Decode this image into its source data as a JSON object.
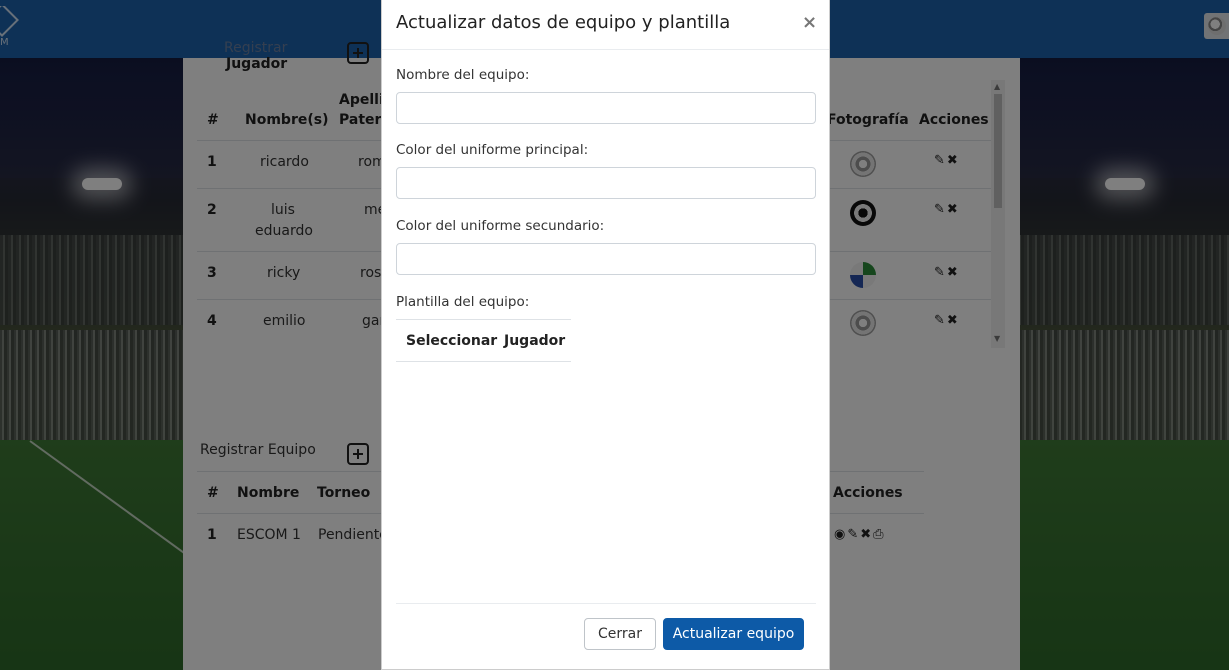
{
  "background": {
    "navbar_color": "#1c63ad"
  },
  "navbar": {
    "brand_text": "M"
  },
  "players_section": {
    "register_label_line1": "Registrar",
    "register_label_line2": "Jugador",
    "headers": {
      "num": "#",
      "names": "Nombre(s)",
      "surname_line1": "Apellid",
      "surname_line2": "Patern",
      "photo": "Fotografía",
      "actions": "Acciones"
    },
    "rows": [
      {
        "num": "1",
        "name": "ricardo",
        "surname": "rom",
        "photo": "gray-ball"
      },
      {
        "num": "2",
        "name_line1": "luis",
        "name_line2": "eduardo",
        "surname": "me",
        "photo": "black-ball"
      },
      {
        "num": "3",
        "name": "ricky",
        "surname": "rosa",
        "photo": "color-ball"
      },
      {
        "num": "4",
        "name": "emilio",
        "surname": "gar",
        "photo": "gray-ball"
      }
    ]
  },
  "teams_section": {
    "register_label": "Registrar Equipo",
    "headers": {
      "num": "#",
      "name": "Nombre",
      "tournament": "Torneo",
      "actions": "Acciones"
    },
    "rows": [
      {
        "num": "1",
        "name": "ESCOM 1",
        "tournament": "Pendiente"
      }
    ]
  },
  "modal": {
    "title": "Actualizar datos de equipo y plantilla",
    "close_symbol": "×",
    "team_name_label": "Nombre del equipo:",
    "team_name_value": "",
    "primary_color_label": "Color del uniforme principal:",
    "primary_color_value": "",
    "secondary_color_label": "Color del uniforme secundario:",
    "secondary_color_value": "",
    "roster_label": "Plantilla del equipo:",
    "roster_headers": {
      "select": "Seleccionar",
      "player": "Jugador"
    },
    "buttons": {
      "close": "Cerrar",
      "update": "Actualizar equipo"
    },
    "update_button_color": "#0d5aa7"
  }
}
